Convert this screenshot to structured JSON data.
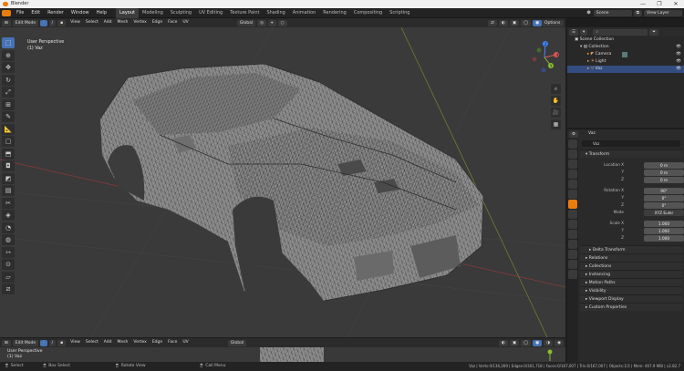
{
  "app": {
    "title": "Blender"
  },
  "window_controls": [
    "—",
    "❐",
    "✕"
  ],
  "menu": [
    "File",
    "Edit",
    "Render",
    "Window",
    "Help"
  ],
  "workspaces": [
    "Layout",
    "Modeling",
    "Sculpting",
    "UV Editing",
    "Texture Paint",
    "Shading",
    "Animation",
    "Rendering",
    "Compositing",
    "Scripting"
  ],
  "active_workspace": "Layout",
  "scene": {
    "label": "Scene",
    "view_layer": "View Layer"
  },
  "viewport_header": {
    "mode": "Edit Mode",
    "menus": [
      "View",
      "Select",
      "Add",
      "Mesh",
      "Vertex",
      "Edge",
      "Face",
      "UV"
    ],
    "transform": "Global",
    "options": "Options",
    "xyz": [
      "X",
      "Y",
      "Z"
    ]
  },
  "viewport": {
    "overlay_title": "User Perspective",
    "overlay_obj": "(1) Vaz"
  },
  "gizmo": {
    "x": "X",
    "y": "Y",
    "z": "Z"
  },
  "outliner": {
    "title": "Scene Collection",
    "items": [
      {
        "label": "Collection",
        "indent": 1
      },
      {
        "label": "Camera",
        "indent": 2
      },
      {
        "label": "Light",
        "indent": 2
      },
      {
        "label": "Vaz",
        "indent": 2,
        "selected": true
      }
    ]
  },
  "properties": {
    "object_name": "Vaz",
    "name_field": "Vaz",
    "transform_title": "Transform",
    "location": [
      {
        "label": "Location X",
        "value": "0 m"
      },
      {
        "label": "Y",
        "value": "0 m"
      },
      {
        "label": "Z",
        "value": "0 m"
      }
    ],
    "rotation": [
      {
        "label": "Rotation X",
        "value": "90°"
      },
      {
        "label": "Y",
        "value": "0°"
      },
      {
        "label": "Z",
        "value": "0°"
      }
    ],
    "mode": {
      "label": "Mode",
      "value": "XYZ Euler"
    },
    "scale": [
      {
        "label": "Scale X",
        "value": "1.000"
      },
      {
        "label": "Y",
        "value": "1.000"
      },
      {
        "label": "Z",
        "value": "1.000"
      }
    ],
    "delta": "Delta Transform",
    "panels": [
      "Relations",
      "Collections",
      "Instancing",
      "Motion Paths",
      "Visibility",
      "Viewport Display",
      "Custom Properties"
    ]
  },
  "bottom_editor": {
    "mode": "Edit Mode",
    "menus": [
      "View",
      "Select",
      "Add",
      "Mesh",
      "Vertex",
      "Edge",
      "Face",
      "UV"
    ],
    "overlay_title": "User Perspective",
    "overlay_obj": "(1) Vaz",
    "sculpt": "Global"
  },
  "statusbar": {
    "left": [
      "Select",
      "Box Select",
      "Rotate View",
      "Call Menu"
    ],
    "right": "Vaz | Verts:0/136,269 | Edges:0/301,718 | Faces:0/167,007 | Tris:0/167,007 | Objects:1/3 | Mem: 467.9 MiB | v2.82.7"
  },
  "colors": {
    "accent": "#4772b3",
    "orange": "#e87d0d",
    "bg": "#3a3a3a"
  }
}
